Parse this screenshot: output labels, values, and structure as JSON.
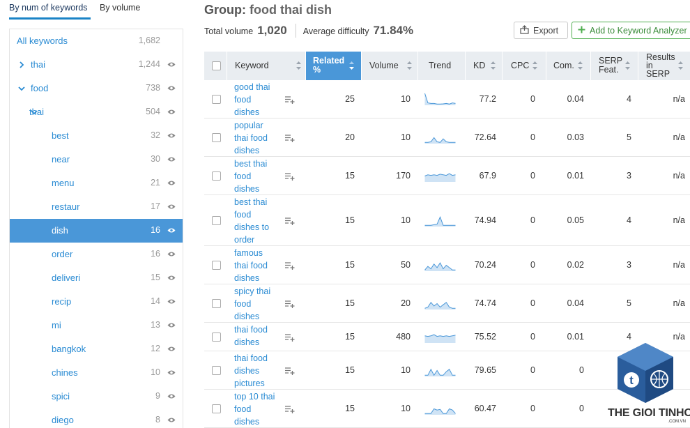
{
  "tabs": [
    "By num of keywords",
    "By volume"
  ],
  "tree": [
    {
      "label": "All keywords",
      "count": "1,682",
      "indent": 0,
      "chevron": "",
      "eye": false,
      "selected": false
    },
    {
      "label": "thai",
      "count": "1,244",
      "indent": 0,
      "chevron": "right",
      "eye": true,
      "selected": false
    },
    {
      "label": "food",
      "count": "738",
      "indent": 0,
      "chevron": "down",
      "eye": true,
      "selected": false
    },
    {
      "label": "thai",
      "count": "504",
      "indent": 1,
      "chevron": "down",
      "eye": true,
      "selected": false
    },
    {
      "label": "best",
      "count": "32",
      "indent": 2,
      "chevron": "",
      "eye": true,
      "selected": false
    },
    {
      "label": "near",
      "count": "30",
      "indent": 2,
      "chevron": "",
      "eye": true,
      "selected": false
    },
    {
      "label": "menu",
      "count": "21",
      "indent": 2,
      "chevron": "",
      "eye": true,
      "selected": false
    },
    {
      "label": "restaur",
      "count": "17",
      "indent": 2,
      "chevron": "",
      "eye": true,
      "selected": false
    },
    {
      "label": "dish",
      "count": "16",
      "indent": 2,
      "chevron": "",
      "eye": true,
      "selected": true
    },
    {
      "label": "order",
      "count": "16",
      "indent": 2,
      "chevron": "",
      "eye": true,
      "selected": false
    },
    {
      "label": "deliveri",
      "count": "15",
      "indent": 2,
      "chevron": "",
      "eye": true,
      "selected": false
    },
    {
      "label": "recip",
      "count": "14",
      "indent": 2,
      "chevron": "",
      "eye": true,
      "selected": false
    },
    {
      "label": "mi",
      "count": "13",
      "indent": 2,
      "chevron": "",
      "eye": true,
      "selected": false
    },
    {
      "label": "bangkok",
      "count": "12",
      "indent": 2,
      "chevron": "",
      "eye": true,
      "selected": false
    },
    {
      "label": "chines",
      "count": "10",
      "indent": 2,
      "chevron": "",
      "eye": true,
      "selected": false
    },
    {
      "label": "spici",
      "count": "9",
      "indent": 2,
      "chevron": "",
      "eye": true,
      "selected": false
    },
    {
      "label": "diego",
      "count": "8",
      "indent": 2,
      "chevron": "",
      "eye": true,
      "selected": false
    }
  ],
  "header": {
    "group_label": "Group:",
    "group_name": "food thai dish",
    "total_volume_label": "Total volume",
    "total_volume": "1,020",
    "avg_difficulty_label": "Average difficulty",
    "avg_difficulty": "71.84%",
    "export_label": "Export",
    "add_label": "Add to Keyword Analyzer"
  },
  "columns": {
    "keyword": "Keyword",
    "related": "Related %",
    "volume": "Volume",
    "trend": "Trend",
    "kd": "KD",
    "cpc": "CPC",
    "com": "Com.",
    "serp": "SERP Feat.",
    "results": "Results in SERP"
  },
  "rows": [
    {
      "keyword": "good thai food dishes",
      "related": "25",
      "volume": "10",
      "kd": "77.2",
      "cpc": "0",
      "com": "0.04",
      "serp": "4",
      "results": "n/a",
      "trend": [
        1,
        0.2,
        0.15,
        0.15,
        0.1,
        0.1,
        0.12,
        0.15,
        0.1,
        0.2,
        0.15
      ]
    },
    {
      "keyword": "popular thai food dishes",
      "related": "20",
      "volume": "10",
      "kd": "72.64",
      "cpc": "0",
      "com": "0.03",
      "serp": "5",
      "results": "n/a",
      "trend": [
        0.1,
        0.1,
        0.15,
        0.5,
        0.15,
        0.1,
        0.4,
        0.15,
        0.1,
        0.1,
        0.1
      ]
    },
    {
      "keyword": "best thai food dishes",
      "related": "15",
      "volume": "170",
      "kd": "67.9",
      "cpc": "0",
      "com": "0.01",
      "serp": "3",
      "results": "n/a",
      "trend": [
        0.5,
        0.6,
        0.55,
        0.6,
        0.55,
        0.65,
        0.6,
        0.55,
        0.7,
        0.55,
        0.6
      ]
    },
    {
      "keyword": "best thai food dishes to order",
      "related": "15",
      "volume": "10",
      "kd": "74.94",
      "cpc": "0",
      "com": "0.05",
      "serp": "4",
      "results": "n/a",
      "trend": [
        0.1,
        0.1,
        0.1,
        0.15,
        0.2,
        0.8,
        0.1,
        0.1,
        0.1,
        0.1,
        0.1
      ]
    },
    {
      "keyword": "famous thai food dishes",
      "related": "15",
      "volume": "50",
      "kd": "70.24",
      "cpc": "0",
      "com": "0.02",
      "serp": "3",
      "results": "n/a",
      "trend": [
        0.1,
        0.4,
        0.2,
        0.6,
        0.3,
        0.7,
        0.2,
        0.5,
        0.3,
        0.1,
        0.1
      ]
    },
    {
      "keyword": "spicy thai food dishes",
      "related": "15",
      "volume": "20",
      "kd": "74.74",
      "cpc": "0",
      "com": "0.04",
      "serp": "5",
      "results": "n/a",
      "trend": [
        0.1,
        0.2,
        0.6,
        0.3,
        0.5,
        0.2,
        0.4,
        0.6,
        0.2,
        0.1,
        0.1
      ]
    },
    {
      "keyword": "thai food dishes",
      "related": "15",
      "volume": "480",
      "kd": "75.52",
      "cpc": "0",
      "com": "0.01",
      "serp": "4",
      "results": "n/a",
      "trend": [
        0.6,
        0.55,
        0.6,
        0.7,
        0.55,
        0.6,
        0.55,
        0.6,
        0.55,
        0.6,
        0.65
      ]
    },
    {
      "keyword": "thai food dishes pictures",
      "related": "15",
      "volume": "10",
      "kd": "79.65",
      "cpc": "0",
      "com": "0",
      "serp": "",
      "results": "",
      "trend": [
        0.1,
        0.1,
        0.6,
        0.1,
        0.5,
        0.1,
        0.1,
        0.4,
        0.6,
        0.1,
        0.1
      ]
    },
    {
      "keyword": "top 10 thai food dishes",
      "related": "15",
      "volume": "10",
      "kd": "60.47",
      "cpc": "0",
      "com": "0",
      "serp": "",
      "results": "",
      "trend": [
        0.1,
        0.1,
        0.1,
        0.5,
        0.4,
        0.45,
        0.1,
        0.1,
        0.5,
        0.4,
        0.1
      ]
    }
  ],
  "watermark": {
    "text": "THE GIOI TINHOC",
    "subtext": ".COM.VN"
  },
  "colors": {
    "accent": "#4a97d8",
    "link": "#2a8bd3",
    "green": "#4fae4f"
  }
}
